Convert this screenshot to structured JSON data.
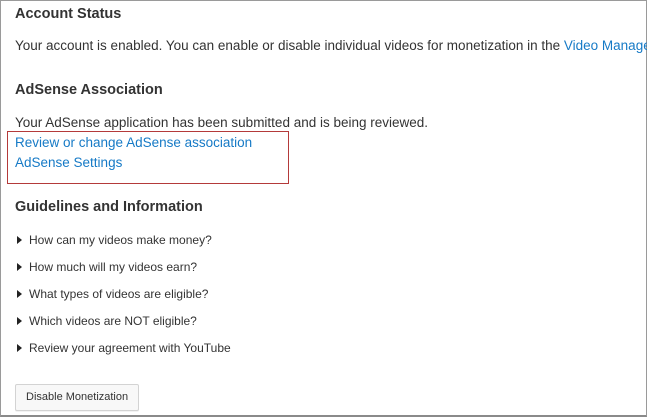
{
  "account_status": {
    "title": "Account Status",
    "text_before": "Your account is enabled. You can enable or disable individual videos for monetization in the ",
    "link": "Video Manager",
    "text_after": "."
  },
  "adsense": {
    "title": "AdSense Association",
    "status_text": "Your AdSense application has been submitted and is being reviewed.",
    "review_link": "Review or change AdSense association",
    "settings_link": "AdSense Settings"
  },
  "guidelines": {
    "title": "Guidelines and Information",
    "items": [
      "How can my videos make money?",
      "How much will my videos earn?",
      "What types of videos are eligible?",
      "Which videos are NOT eligible?",
      "Review your agreement with YouTube"
    ]
  },
  "actions": {
    "disable_label": "Disable Monetization"
  },
  "colors": {
    "link": "#167ac6",
    "highlight_border": "#b43a3a"
  }
}
